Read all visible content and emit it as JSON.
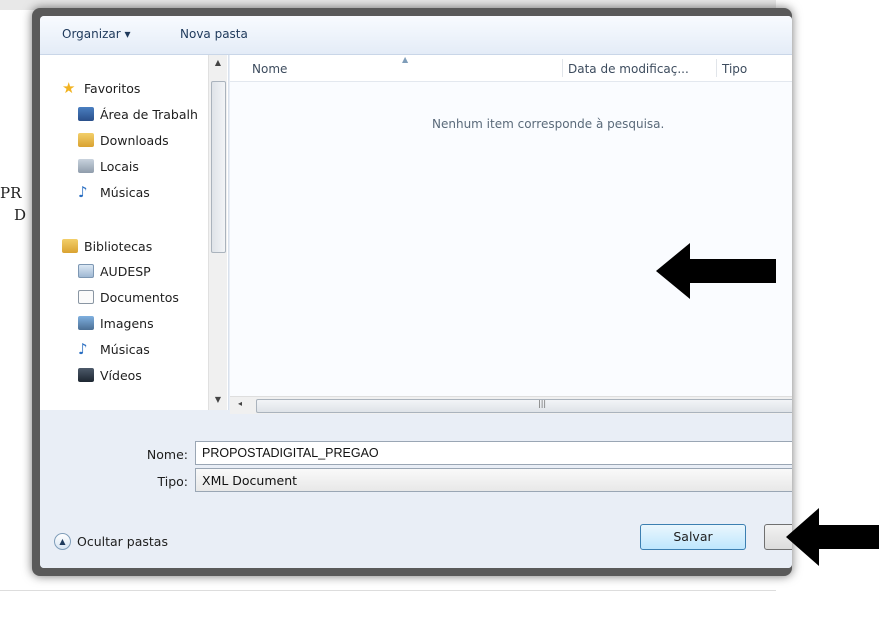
{
  "toolbar": {
    "organize_label": "Organizar ▾",
    "new_folder_label": "Nova pasta"
  },
  "nav": {
    "favorites": {
      "label": "Favoritos",
      "items": [
        "Área de Trabalh",
        "Downloads",
        "Locais",
        "Músicas"
      ]
    },
    "libraries": {
      "label": "Bibliotecas",
      "items": [
        "AUDESP",
        "Documentos",
        "Imagens",
        "Músicas",
        "Vídeos"
      ]
    }
  },
  "columns": {
    "name": "Nome",
    "date": "Data de modificaç...",
    "type": "Tipo"
  },
  "content": {
    "empty_message": "Nenhum item corresponde à pesquisa."
  },
  "form": {
    "name_label": "Nome:",
    "name_value": "PROPOSTADIGITAL_PREGAO",
    "type_label": "Tipo:",
    "type_value": "XML Document"
  },
  "footer": {
    "hide_folders_label": "Ocultar pastas",
    "save_label": "Salvar"
  },
  "background": {
    "frag_pr": "PR",
    "frag_d": "D"
  },
  "colors": {
    "save_button_border": "#3c7fb1",
    "folder": "#e8b84a",
    "star": "#f2b321"
  }
}
